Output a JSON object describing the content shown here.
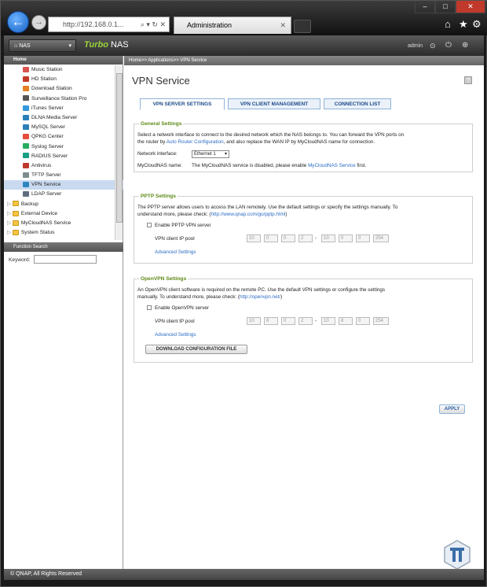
{
  "browser": {
    "address": "http://192.168.0.1...",
    "tab_title": "Administration"
  },
  "header": {
    "nas_dropdown": "NAS",
    "brand_prefix": "Turbo",
    "brand_suffix": "NAS",
    "user": "admin"
  },
  "sidebar": {
    "title": "Home",
    "items": [
      {
        "label": "Music Station",
        "color": "#d9534f"
      },
      {
        "label": "HD Station",
        "color": "#c0392b"
      },
      {
        "label": "Download Station",
        "color": "#e67e22"
      },
      {
        "label": "Surveillance Station Pro",
        "color": "#555555"
      },
      {
        "label": "iTunes Server",
        "color": "#3498db"
      },
      {
        "label": "DLNA Media Server",
        "color": "#2980b9"
      },
      {
        "label": "MySQL Server",
        "color": "#2c7fb8"
      },
      {
        "label": "QPKG Center",
        "color": "#e74c3c"
      },
      {
        "label": "Syslog Server",
        "color": "#27ae60"
      },
      {
        "label": "RADIUS Server",
        "color": "#16a085"
      },
      {
        "label": "Antivirus",
        "color": "#c0392b"
      },
      {
        "label": "TFTP Server",
        "color": "#7f8c8d"
      },
      {
        "label": "VPN Service",
        "color": "#2e86c1",
        "selected": true
      },
      {
        "label": "LDAP Server",
        "color": "#5d6d7e"
      }
    ],
    "folders": [
      "Backup",
      "External Device",
      "MyCloudNAS Service",
      "System Status"
    ],
    "function_search": "Function Search",
    "keyword_label": "Keyword:"
  },
  "breadcrumb": "Home>> Applications>> VPN Service",
  "page": {
    "title": "VPN Service",
    "tabs": [
      "VPN SERVER SETTINGS",
      "VPN CLIENT MANAGEMENT",
      "CONNECTION LIST"
    ],
    "general": {
      "legend": "General Settings",
      "desc1": "Select a network interface to connect to the desired network which the NAS belongs to. You can forward the VPN ports on",
      "desc2_pre": "the router by",
      "desc2_link": "Auto Router Configuration",
      "desc2_post": ", and also replace the WAN IP by MyCloudNAS name for connection.",
      "iface_label": "Network interface:",
      "iface_value": "Ethernet 1",
      "mcn_label": "MyCloudNAS name:",
      "mcn_pre": "The MyCloudNAS service is disabled, please enable",
      "mcn_link": "MyCloudNAS Service",
      "mcn_post": "first."
    },
    "pptp": {
      "legend": "PPTP Settings",
      "desc1": "The PPTP server allows users to access the LAN remotely. Use the default settings or specify the settings manually. To",
      "desc2_pre": "understand more, please check: (",
      "desc2_link": "http://www.qnap.com/go/pptp.html",
      "desc2_post": ")",
      "enable": "Enable PPTP VPN server",
      "pool_label": "VPN client IP pool",
      "ip_start": [
        "10",
        "0",
        "0",
        "2"
      ],
      "ip_end": [
        "10",
        "0",
        "0",
        "254"
      ],
      "advanced": "Advanced Settings"
    },
    "openvpn": {
      "legend": "OpenVPN Settings",
      "desc1": "An OpenVPN client software is required on the remote PC. Use the default VPN settings or configure the settings",
      "desc2_pre": "manually. To understand more, please check: (",
      "desc2_link": "http://openvpn.net/",
      "desc2_post": ")",
      "enable": "Enable OpenVPN server",
      "pool_label": "VPN client IP pool",
      "ip_start": [
        "10",
        "8",
        "0",
        "2"
      ],
      "ip_end": [
        "10",
        "8",
        "0",
        "254"
      ],
      "advanced": "Advanced Settings",
      "download": "DOWNLOAD CONFIGURATION FILE"
    },
    "apply": "APPLY"
  },
  "footer": "© QNAP, All Rights Reserved"
}
